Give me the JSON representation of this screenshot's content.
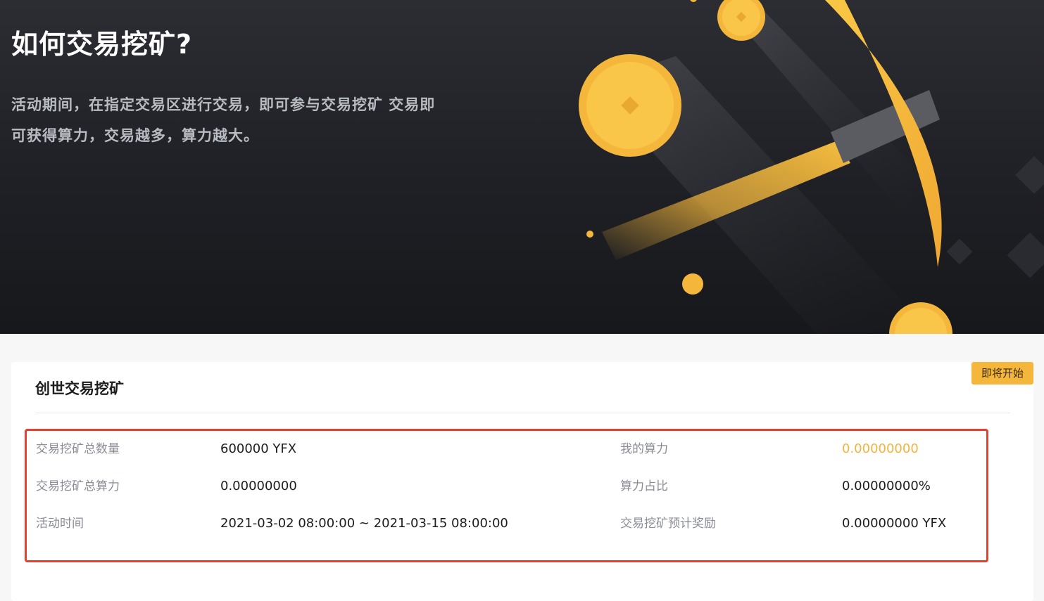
{
  "hero": {
    "title": "如何交易挖矿?",
    "description": "活动期间，在指定交易区进行交易，即可参与交易挖矿 交易即可获得算力，交易越多，算力越大。"
  },
  "card": {
    "title": "创世交易挖矿",
    "status_badge": "即将开始",
    "rows": [
      {
        "label_left": "交易挖矿总数量",
        "value_left": "600000 YFX",
        "label_right": "我的算力",
        "value_right": "0.00000000"
      },
      {
        "label_left": "交易挖矿总算力",
        "value_left": "0.00000000",
        "label_right": "算力占比",
        "value_right": "0.00000000%"
      },
      {
        "label_left": "活动时间",
        "value_left": "2021-03-02 08:00:00 ~ 2021-03-15 08:00:00",
        "label_right": "交易挖矿预计奖励",
        "value_right": "0.00000000 YFX"
      }
    ]
  },
  "colors": {
    "hero_background": "#1f2025",
    "accent_gold": "#f5b73b",
    "highlight_border": "#e0422f",
    "label_gray": "#8a8d96",
    "value_dark": "#1d1d1f"
  },
  "icons": {
    "hero_illustration": "pickaxe-with-gold-coins-icon"
  }
}
